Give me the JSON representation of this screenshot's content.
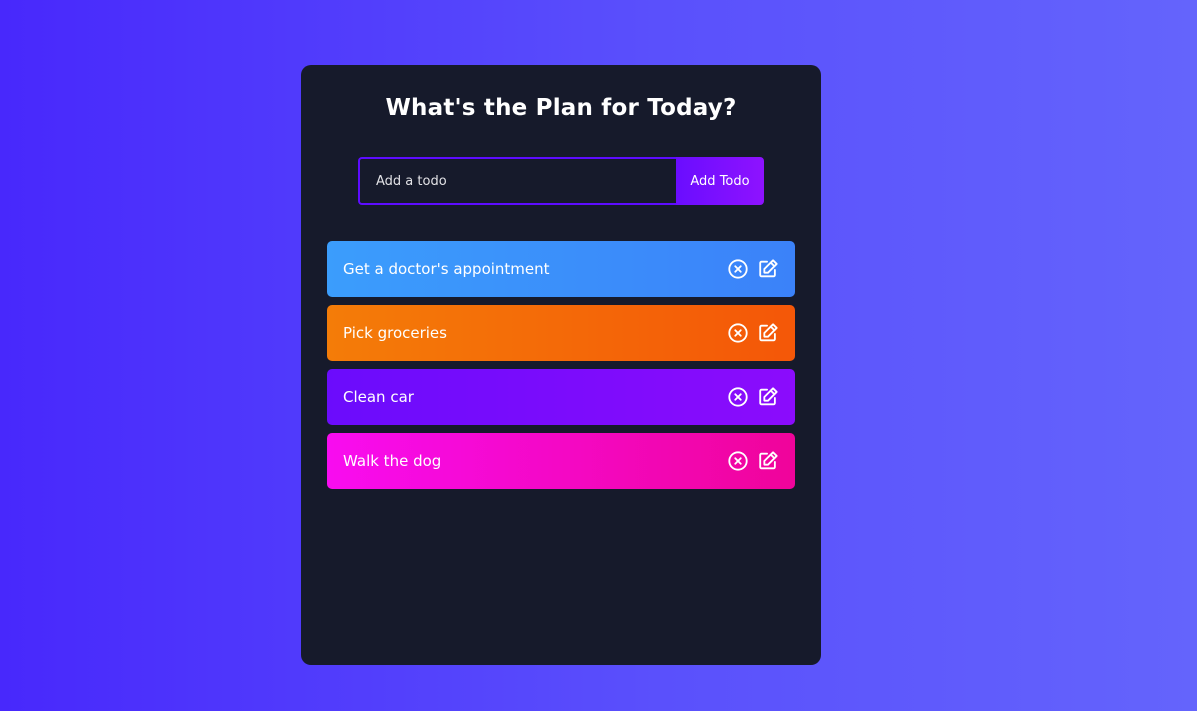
{
  "app": {
    "title": "What's the Plan for Today?"
  },
  "form": {
    "placeholder": "Add a todo",
    "value": "",
    "add_label": "Add Todo"
  },
  "todos": [
    {
      "text": "Get a doctor's appointment",
      "color_from": "#3b9dfc",
      "color_to": "#3b82f9"
    },
    {
      "text": "Pick groceries",
      "color_from": "#f47c08",
      "color_to": "#f45708"
    },
    {
      "text": "Clean car",
      "color_from": "#6b0cfc",
      "color_to": "#8b0cfc"
    },
    {
      "text": "Walk the dog",
      "color_from": "#f80cf0",
      "color_to": "#f0049a"
    }
  ],
  "icons": {
    "delete": "close-circle-icon",
    "edit": "edit-icon"
  },
  "colors": {
    "background_from": "#4828fc",
    "background_to": "#6464fc",
    "panel": "#161a2b",
    "accent": "#5d0cff"
  }
}
